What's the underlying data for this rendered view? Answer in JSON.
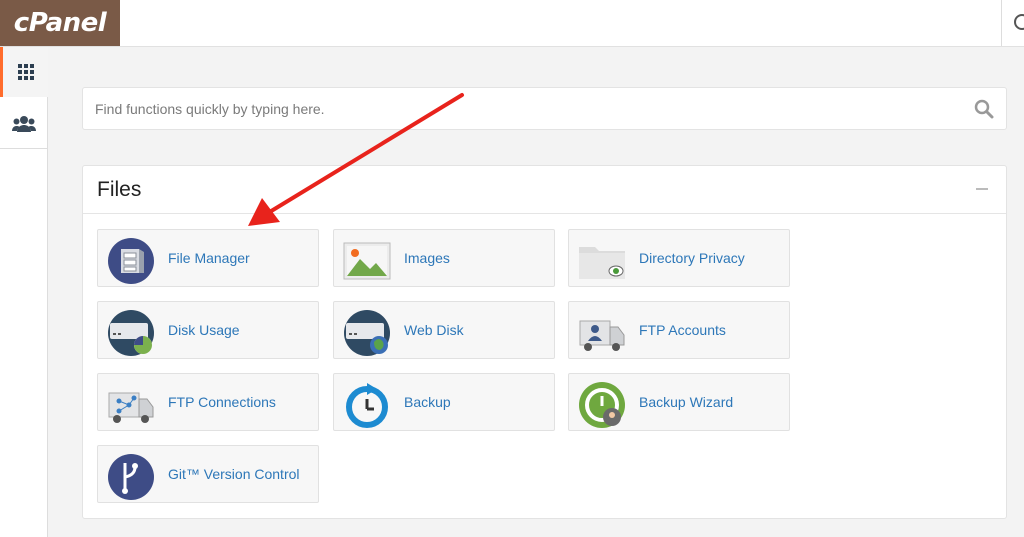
{
  "header": {
    "logo_text": "cPanel"
  },
  "nav": {
    "items": [
      {
        "name": "tools",
        "icon": "grid-icon",
        "active": true
      },
      {
        "name": "user-manager",
        "icon": "users-icon",
        "active": false
      }
    ]
  },
  "search": {
    "placeholder": "Find functions quickly by typing here.",
    "value": ""
  },
  "files_panel": {
    "title": "Files",
    "items": [
      {
        "label": "File Manager",
        "icon": "file-manager-icon"
      },
      {
        "label": "Images",
        "icon": "images-icon"
      },
      {
        "label": "Directory Privacy",
        "icon": "directory-privacy-icon"
      },
      {
        "label": "Disk Usage",
        "icon": "disk-usage-icon"
      },
      {
        "label": "Web Disk",
        "icon": "web-disk-icon"
      },
      {
        "label": "FTP Accounts",
        "icon": "ftp-accounts-icon"
      },
      {
        "label": "FTP Connections",
        "icon": "ftp-connections-icon"
      },
      {
        "label": "Backup",
        "icon": "backup-icon"
      },
      {
        "label": "Backup Wizard",
        "icon": "backup-wizard-icon"
      },
      {
        "label": "Git™ Version Control",
        "icon": "git-icon"
      }
    ]
  },
  "colors": {
    "logo_bg": "#7a5a47",
    "accent": "#ff6c2c",
    "link": "#2d77b8",
    "annotation_arrow": "#e8231c"
  }
}
